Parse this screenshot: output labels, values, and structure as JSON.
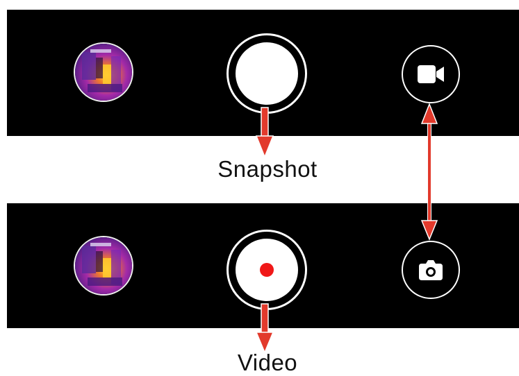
{
  "captions": {
    "snapshot": "Snapshot",
    "video": "Video"
  },
  "photo_mode_bar": {
    "gallery_thumbnail": "thermal-image-thumbnail",
    "shutter": "snapshot-shutter",
    "mode_switch_icon": "video-camera-icon"
  },
  "video_mode_bar": {
    "gallery_thumbnail": "thermal-image-thumbnail",
    "shutter": "record-shutter",
    "mode_switch_icon": "photo-camera-icon"
  },
  "colors": {
    "bar": "#000000",
    "arrow_fill": "#e23a2c",
    "arrow_outline": "#ffffff",
    "record_dot": "#f01818"
  }
}
